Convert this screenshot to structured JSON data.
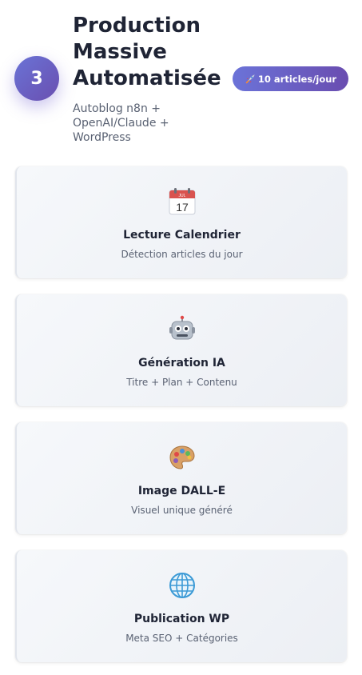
{
  "step": {
    "number": "3",
    "title": "Production Massive Automatisée",
    "subtitle": "Autoblog n8n + OpenAI/Claude + WordPress",
    "badge": {
      "icon": "rocket-icon",
      "label": "10 articles/jour"
    }
  },
  "cards": [
    {
      "icon": "calendar-icon",
      "title": "Lecture Calendrier",
      "description": "Détection articles du jour",
      "icon_text": "17",
      "icon_month": "JUL"
    },
    {
      "icon": "robot-icon",
      "title": "Génération IA",
      "description": "Titre + Plan + Contenu"
    },
    {
      "icon": "palette-icon",
      "title": "Image DALL-E",
      "description": "Visuel unique généré"
    },
    {
      "icon": "globe-icon",
      "title": "Publication WP",
      "description": "Meta SEO + Catégories"
    }
  ],
  "colors": {
    "accent_start": "#6a73d6",
    "accent_end": "#6a4fb0",
    "heading": "#1f2435",
    "text_muted": "#5a6273"
  }
}
